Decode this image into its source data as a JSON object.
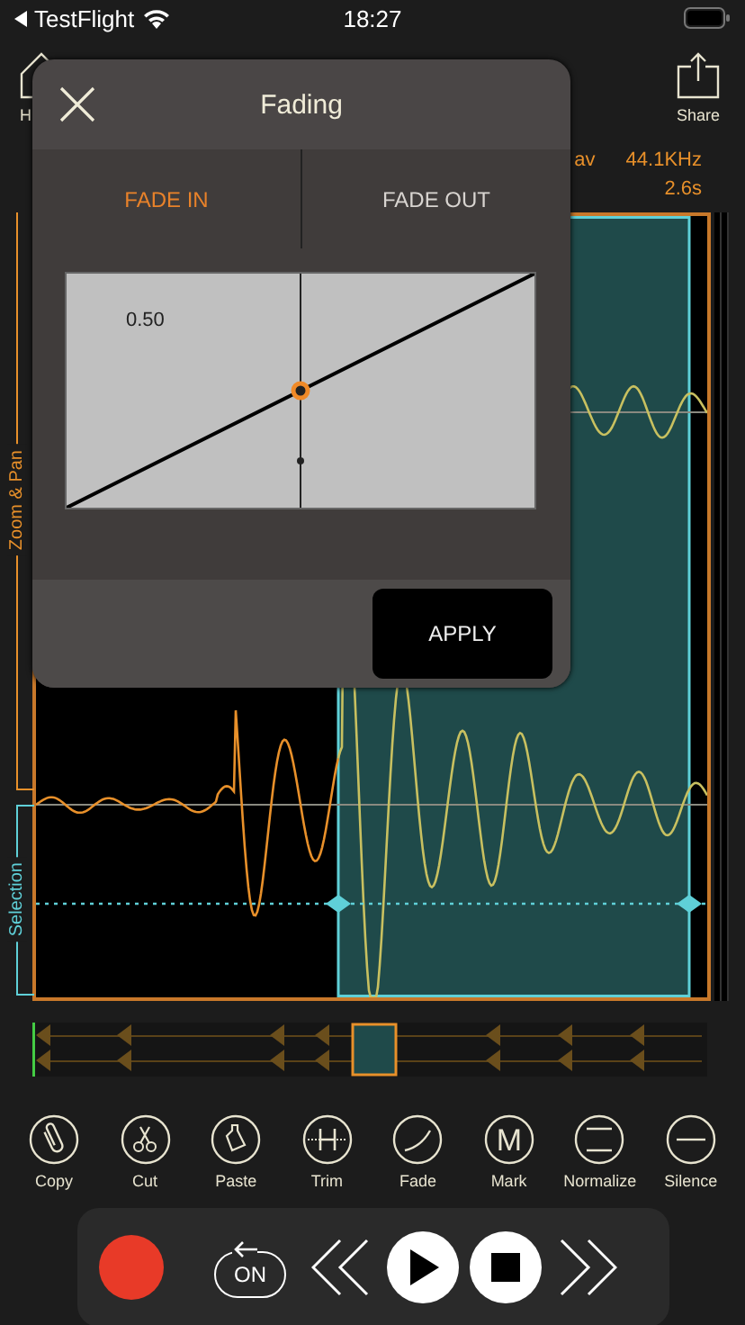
{
  "status_bar": {
    "back_label": "TestFlight",
    "time": "18:27"
  },
  "toolbar": {
    "home_label": "H",
    "share_label": "Share"
  },
  "info": {
    "format": "av",
    "sample_rate": "44.1KHz",
    "duration": "2.6s"
  },
  "editor": {
    "zoom_label": "Zoom & Pan",
    "selection_label": "Selection"
  },
  "tools": [
    {
      "kind": "clip",
      "label": "Copy"
    },
    {
      "kind": "scissors",
      "label": "Cut"
    },
    {
      "kind": "bottle",
      "label": "Paste"
    },
    {
      "kind": "trim",
      "label": "Trim"
    },
    {
      "kind": "fade",
      "label": "Fade"
    },
    {
      "kind": "mark",
      "label": "Mark",
      "glyph": "M"
    },
    {
      "kind": "normalize",
      "label": "Normalize"
    },
    {
      "kind": "silence",
      "label": "Silence"
    }
  ],
  "transport": {
    "loop_label": "ON"
  },
  "dialog": {
    "title": "Fading",
    "tabs": [
      {
        "label": "FADE IN",
        "selected": true
      },
      {
        "label": "FADE OUT",
        "selected": false
      }
    ],
    "curve_value": "0.50",
    "apply_label": "APPLY"
  }
}
